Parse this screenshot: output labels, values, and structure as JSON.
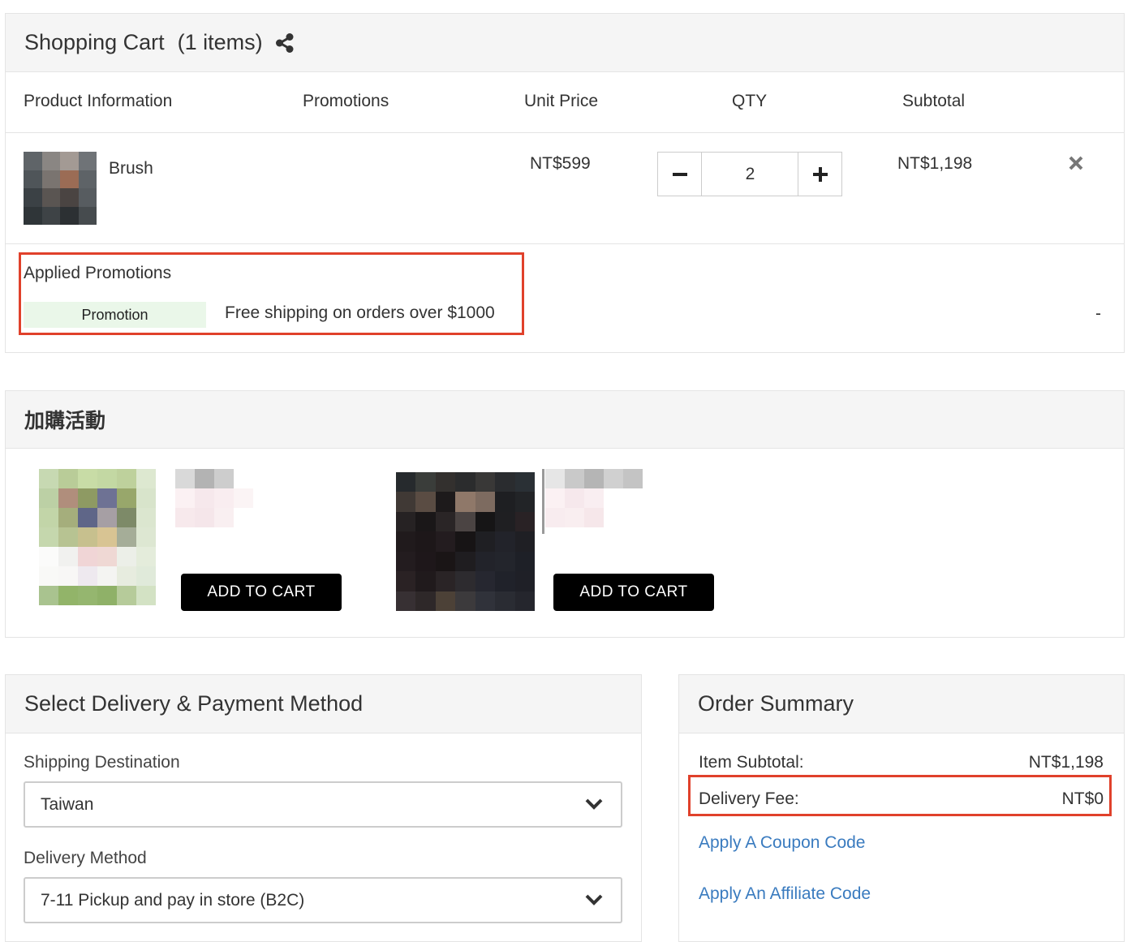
{
  "cart": {
    "title": "Shopping Cart",
    "count_text": "(1 items)",
    "columns": {
      "product": "Product Information",
      "promotions": "Promotions",
      "unit_price": "Unit Price",
      "qty": "QTY",
      "subtotal": "Subtotal"
    },
    "item": {
      "name": "Brush",
      "unit_price": "NT$599",
      "quantity": "2",
      "subtotal": "NT$1,198"
    },
    "applied_promotions": {
      "title": "Applied Promotions",
      "tag": "Promotion",
      "description": "Free shipping on orders over $1000",
      "amount": "-"
    }
  },
  "addon": {
    "title": "加購活動",
    "button_label": "ADD TO CART"
  },
  "delivery": {
    "title": "Select Delivery & Payment Method",
    "destination_label": "Shipping Destination",
    "destination_value": "Taiwan",
    "method_label": "Delivery Method",
    "method_value": "7-11 Pickup and pay in store (B2C)"
  },
  "summary": {
    "title": "Order Summary",
    "item_subtotal_label": "Item Subtotal:",
    "item_subtotal_value": "NT$1,198",
    "delivery_fee_label": "Delivery Fee:",
    "delivery_fee_value": "NT$0",
    "coupon_link": "Apply A Coupon Code",
    "affiliate_link": "Apply An Affiliate Code"
  },
  "colors": {
    "highlight": "#e0412b",
    "link": "#3a7bbf",
    "promo_tag_bg": "#eaf7e9",
    "button_bg": "#000000"
  },
  "icons": [
    "share-icon",
    "minus-icon",
    "plus-icon",
    "remove-icon",
    "chevron-down-icon"
  ]
}
